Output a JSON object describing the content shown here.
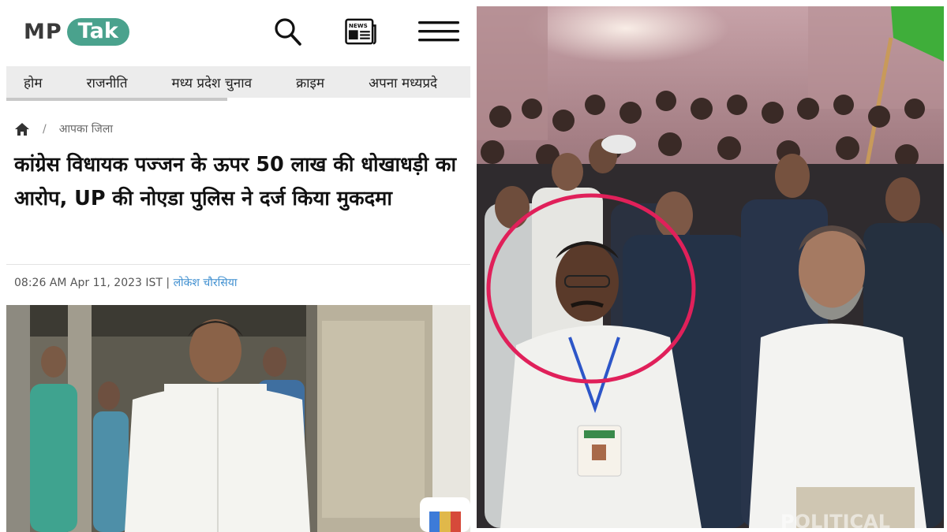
{
  "site": {
    "logo_mp": "MP",
    "logo_tak": "Tak",
    "search_icon": "search-icon",
    "news_icon": "newspaper-icon",
    "news_icon_label": "NEWS",
    "menu_icon": "hamburger-menu-icon"
  },
  "nav": {
    "items": [
      {
        "label": "होम"
      },
      {
        "label": "राजनीति"
      },
      {
        "label": "मध्य प्रदेश चुनाव"
      },
      {
        "label": "क्राइम"
      },
      {
        "label": "अपना मध्यप्रदे"
      }
    ]
  },
  "breadcrumb": {
    "home_icon": "home-icon",
    "separator": "/",
    "section": "आपका जिला"
  },
  "article": {
    "headline": "कांग्रेस विधायक पज्जन के ऊपर 50 लाख की धोखाधड़ी का आरोप, UP की नोएडा पुलिस ने दर्ज किया मुकदमा",
    "timestamp": "08:26 AM Apr 11, 2023 IST",
    "meta_separator": "|",
    "author": "लोकेश चौरसिया"
  },
  "right_photo": {
    "watermark": "POLITICAL",
    "highlight_color": "#e0205a"
  },
  "colors": {
    "brand": "#4aa28d",
    "author_link": "#3f8fd0",
    "nav_bg": "#ececec"
  }
}
